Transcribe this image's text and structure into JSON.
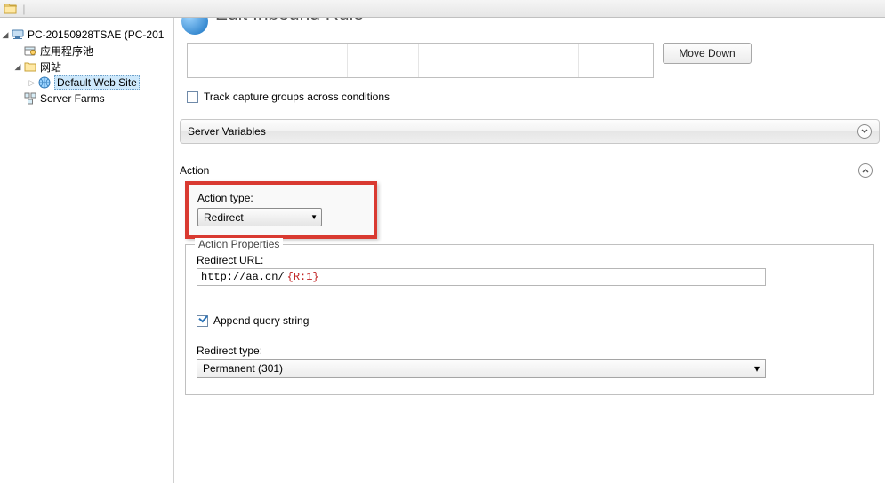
{
  "toolbar": {},
  "sidebar": {
    "root": "PC-20150928TSAE (PC-201",
    "app_pool": "应用程序池",
    "sites": "网站",
    "default_site": "Default Web Site",
    "server_farms": "Server Farms"
  },
  "page": {
    "title": "Edit Inbound Rule"
  },
  "buttons": {
    "move_down": "Move Down"
  },
  "conditions": {
    "track_caption": "Track capture groups across conditions"
  },
  "server_vars": {
    "title": "Server Variables"
  },
  "action": {
    "title": "Action",
    "type_label": "Action type:",
    "type_value": "Redirect",
    "properties_legend": "Action Properties",
    "redirect_url_label": "Redirect URL:",
    "redirect_url_value_prefix": "http://aa.cn/",
    "redirect_url_value_token": "{R:1}",
    "append_query": "Append query string",
    "redirect_type_label": "Redirect type:",
    "redirect_type_value": "Permanent (301)"
  }
}
